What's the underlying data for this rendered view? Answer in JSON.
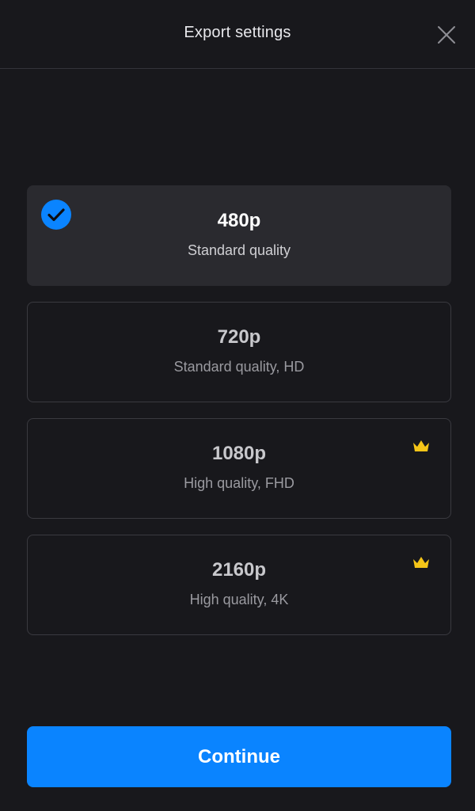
{
  "header": {
    "title": "Export settings"
  },
  "options": [
    {
      "title": "480p",
      "subtitle": "Standard quality",
      "selected": true,
      "premium": false
    },
    {
      "title": "720p",
      "subtitle": "Standard quality, HD",
      "selected": false,
      "premium": false
    },
    {
      "title": "1080p",
      "subtitle": "High quality, FHD",
      "selected": false,
      "premium": true
    },
    {
      "title": "2160p",
      "subtitle": "High quality, 4K",
      "selected": false,
      "premium": true
    }
  ],
  "footer": {
    "continue_label": "Continue"
  },
  "colors": {
    "background": "#18181c",
    "accent": "#0a84ff",
    "premium": "#f5c518"
  },
  "icons": {
    "close": "close-icon",
    "selected": "checkmark-icon",
    "premium": "crown-icon"
  }
}
